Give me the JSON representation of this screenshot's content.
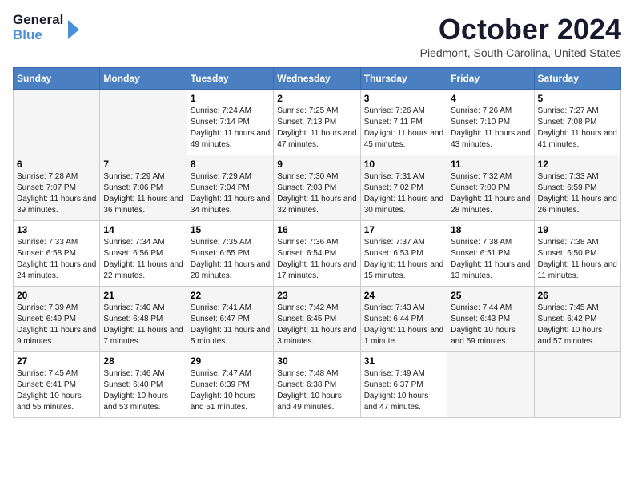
{
  "header": {
    "logo_line1": "General",
    "logo_line2": "Blue",
    "month_title": "October 2024",
    "location": "Piedmont, South Carolina, United States"
  },
  "days_of_week": [
    "Sunday",
    "Monday",
    "Tuesday",
    "Wednesday",
    "Thursday",
    "Friday",
    "Saturday"
  ],
  "weeks": [
    [
      null,
      null,
      {
        "day": 1,
        "sunrise": "Sunrise: 7:24 AM",
        "sunset": "Sunset: 7:14 PM",
        "daylight": "Daylight: 11 hours and 49 minutes."
      },
      {
        "day": 2,
        "sunrise": "Sunrise: 7:25 AM",
        "sunset": "Sunset: 7:13 PM",
        "daylight": "Daylight: 11 hours and 47 minutes."
      },
      {
        "day": 3,
        "sunrise": "Sunrise: 7:26 AM",
        "sunset": "Sunset: 7:11 PM",
        "daylight": "Daylight: 11 hours and 45 minutes."
      },
      {
        "day": 4,
        "sunrise": "Sunrise: 7:26 AM",
        "sunset": "Sunset: 7:10 PM",
        "daylight": "Daylight: 11 hours and 43 minutes."
      },
      {
        "day": 5,
        "sunrise": "Sunrise: 7:27 AM",
        "sunset": "Sunset: 7:08 PM",
        "daylight": "Daylight: 11 hours and 41 minutes."
      }
    ],
    [
      {
        "day": 6,
        "sunrise": "Sunrise: 7:28 AM",
        "sunset": "Sunset: 7:07 PM",
        "daylight": "Daylight: 11 hours and 39 minutes."
      },
      {
        "day": 7,
        "sunrise": "Sunrise: 7:29 AM",
        "sunset": "Sunset: 7:06 PM",
        "daylight": "Daylight: 11 hours and 36 minutes."
      },
      {
        "day": 8,
        "sunrise": "Sunrise: 7:29 AM",
        "sunset": "Sunset: 7:04 PM",
        "daylight": "Daylight: 11 hours and 34 minutes."
      },
      {
        "day": 9,
        "sunrise": "Sunrise: 7:30 AM",
        "sunset": "Sunset: 7:03 PM",
        "daylight": "Daylight: 11 hours and 32 minutes."
      },
      {
        "day": 10,
        "sunrise": "Sunrise: 7:31 AM",
        "sunset": "Sunset: 7:02 PM",
        "daylight": "Daylight: 11 hours and 30 minutes."
      },
      {
        "day": 11,
        "sunrise": "Sunrise: 7:32 AM",
        "sunset": "Sunset: 7:00 PM",
        "daylight": "Daylight: 11 hours and 28 minutes."
      },
      {
        "day": 12,
        "sunrise": "Sunrise: 7:33 AM",
        "sunset": "Sunset: 6:59 PM",
        "daylight": "Daylight: 11 hours and 26 minutes."
      }
    ],
    [
      {
        "day": 13,
        "sunrise": "Sunrise: 7:33 AM",
        "sunset": "Sunset: 6:58 PM",
        "daylight": "Daylight: 11 hours and 24 minutes."
      },
      {
        "day": 14,
        "sunrise": "Sunrise: 7:34 AM",
        "sunset": "Sunset: 6:56 PM",
        "daylight": "Daylight: 11 hours and 22 minutes."
      },
      {
        "day": 15,
        "sunrise": "Sunrise: 7:35 AM",
        "sunset": "Sunset: 6:55 PM",
        "daylight": "Daylight: 11 hours and 20 minutes."
      },
      {
        "day": 16,
        "sunrise": "Sunrise: 7:36 AM",
        "sunset": "Sunset: 6:54 PM",
        "daylight": "Daylight: 11 hours and 17 minutes."
      },
      {
        "day": 17,
        "sunrise": "Sunrise: 7:37 AM",
        "sunset": "Sunset: 6:53 PM",
        "daylight": "Daylight: 11 hours and 15 minutes."
      },
      {
        "day": 18,
        "sunrise": "Sunrise: 7:38 AM",
        "sunset": "Sunset: 6:51 PM",
        "daylight": "Daylight: 11 hours and 13 minutes."
      },
      {
        "day": 19,
        "sunrise": "Sunrise: 7:38 AM",
        "sunset": "Sunset: 6:50 PM",
        "daylight": "Daylight: 11 hours and 11 minutes."
      }
    ],
    [
      {
        "day": 20,
        "sunrise": "Sunrise: 7:39 AM",
        "sunset": "Sunset: 6:49 PM",
        "daylight": "Daylight: 11 hours and 9 minutes."
      },
      {
        "day": 21,
        "sunrise": "Sunrise: 7:40 AM",
        "sunset": "Sunset: 6:48 PM",
        "daylight": "Daylight: 11 hours and 7 minutes."
      },
      {
        "day": 22,
        "sunrise": "Sunrise: 7:41 AM",
        "sunset": "Sunset: 6:47 PM",
        "daylight": "Daylight: 11 hours and 5 minutes."
      },
      {
        "day": 23,
        "sunrise": "Sunrise: 7:42 AM",
        "sunset": "Sunset: 6:45 PM",
        "daylight": "Daylight: 11 hours and 3 minutes."
      },
      {
        "day": 24,
        "sunrise": "Sunrise: 7:43 AM",
        "sunset": "Sunset: 6:44 PM",
        "daylight": "Daylight: 11 hours and 1 minute."
      },
      {
        "day": 25,
        "sunrise": "Sunrise: 7:44 AM",
        "sunset": "Sunset: 6:43 PM",
        "daylight": "Daylight: 10 hours and 59 minutes."
      },
      {
        "day": 26,
        "sunrise": "Sunrise: 7:45 AM",
        "sunset": "Sunset: 6:42 PM",
        "daylight": "Daylight: 10 hours and 57 minutes."
      }
    ],
    [
      {
        "day": 27,
        "sunrise": "Sunrise: 7:45 AM",
        "sunset": "Sunset: 6:41 PM",
        "daylight": "Daylight: 10 hours and 55 minutes."
      },
      {
        "day": 28,
        "sunrise": "Sunrise: 7:46 AM",
        "sunset": "Sunset: 6:40 PM",
        "daylight": "Daylight: 10 hours and 53 minutes."
      },
      {
        "day": 29,
        "sunrise": "Sunrise: 7:47 AM",
        "sunset": "Sunset: 6:39 PM",
        "daylight": "Daylight: 10 hours and 51 minutes."
      },
      {
        "day": 30,
        "sunrise": "Sunrise: 7:48 AM",
        "sunset": "Sunset: 6:38 PM",
        "daylight": "Daylight: 10 hours and 49 minutes."
      },
      {
        "day": 31,
        "sunrise": "Sunrise: 7:49 AM",
        "sunset": "Sunset: 6:37 PM",
        "daylight": "Daylight: 10 hours and 47 minutes."
      },
      null,
      null
    ]
  ]
}
